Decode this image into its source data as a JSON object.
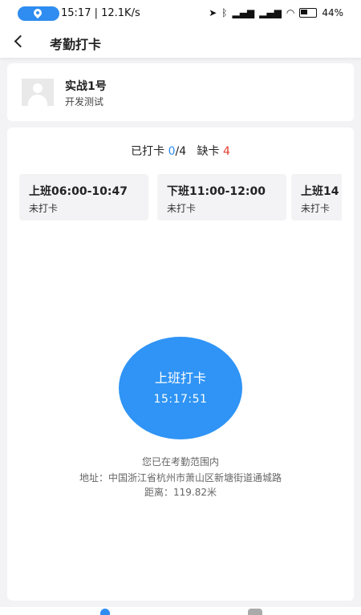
{
  "status_bar": {
    "time_speed": "15:17 | 12.1K/s",
    "battery": "44%"
  },
  "header": {
    "title": "考勤打卡"
  },
  "user": {
    "name": "实战1号",
    "department": "开发测试"
  },
  "summary": {
    "punched_label": "已打卡",
    "punched_count": "0",
    "punched_total": "/4",
    "missing_label": "缺卡",
    "missing_count": "4"
  },
  "shifts": [
    {
      "title": "上班06:00-10:47",
      "status": "未打卡"
    },
    {
      "title": "下班11:00-12:00",
      "status": "未打卡"
    },
    {
      "title": "上班14",
      "status": "未打卡"
    }
  ],
  "punch": {
    "label": "上班打卡",
    "time": "15:17:51"
  },
  "location": {
    "status": "您已在考勤范围内",
    "address": "地址：中国浙江省杭州市萧山区新塘街道通城路",
    "distance": "距离：119.82米"
  }
}
